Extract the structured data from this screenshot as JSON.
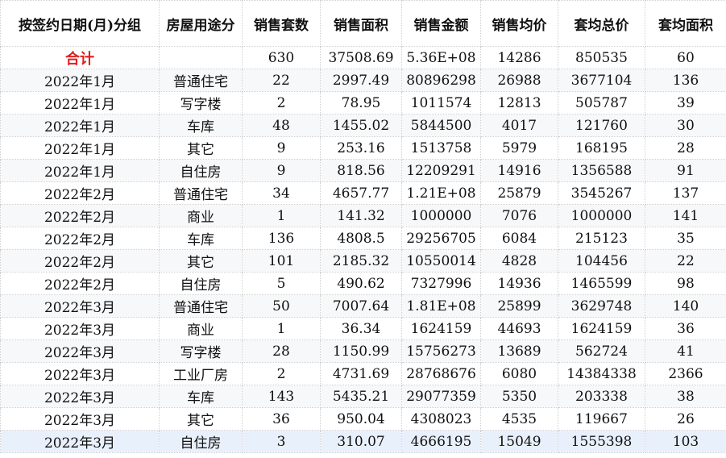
{
  "columns": [
    "按签约日期(月)分组",
    "房屋用途分",
    "销售套数",
    "销售面积",
    "销售金额",
    "销售均价",
    "套均总价",
    "套均面积"
  ],
  "total": {
    "label": "合计",
    "values": [
      "",
      "630",
      "37508.69",
      "5.36E+08",
      "14286",
      "850535",
      "60"
    ]
  },
  "rows": [
    [
      "2022年1月",
      "普通住宅",
      "22",
      "2997.49",
      "80896298",
      "26988",
      "3677104",
      "136"
    ],
    [
      "2022年1月",
      "写字楼",
      "2",
      "78.95",
      "1011574",
      "12813",
      "505787",
      "39"
    ],
    [
      "2022年1月",
      "车库",
      "48",
      "1455.02",
      "5844500",
      "4017",
      "121760",
      "30"
    ],
    [
      "2022年1月",
      "其它",
      "9",
      "253.16",
      "1513758",
      "5979",
      "168195",
      "28"
    ],
    [
      "2022年1月",
      "自住房",
      "9",
      "818.56",
      "12209291",
      "14916",
      "1356588",
      "91"
    ],
    [
      "2022年2月",
      "普通住宅",
      "34",
      "4657.77",
      "1.21E+08",
      "25879",
      "3545267",
      "137"
    ],
    [
      "2022年2月",
      "商业",
      "1",
      "141.32",
      "1000000",
      "7076",
      "1000000",
      "141"
    ],
    [
      "2022年2月",
      "车库",
      "136",
      "4808.5",
      "29256705",
      "6084",
      "215123",
      "35"
    ],
    [
      "2022年2月",
      "其它",
      "101",
      "2185.32",
      "10550014",
      "4828",
      "104456",
      "22"
    ],
    [
      "2022年2月",
      "自住房",
      "5",
      "490.62",
      "7327996",
      "14936",
      "1465599",
      "98"
    ],
    [
      "2022年3月",
      "普通住宅",
      "50",
      "7007.64",
      "1.81E+08",
      "25899",
      "3629748",
      "140"
    ],
    [
      "2022年3月",
      "商业",
      "1",
      "36.34",
      "1624159",
      "44693",
      "1624159",
      "36"
    ],
    [
      "2022年3月",
      "写字楼",
      "28",
      "1150.99",
      "15756273",
      "13689",
      "562724",
      "41"
    ],
    [
      "2022年3月",
      "工业厂房",
      "2",
      "4731.69",
      "28768676",
      "6080",
      "14384338",
      "2366"
    ],
    [
      "2022年3月",
      "车库",
      "143",
      "5435.21",
      "29077359",
      "5350",
      "203338",
      "38"
    ],
    [
      "2022年3月",
      "其它",
      "36",
      "950.04",
      "4308023",
      "4535",
      "119667",
      "26"
    ],
    [
      "2022年3月",
      "自住房",
      "3",
      "310.07",
      "4666195",
      "15049",
      "1555398",
      "103"
    ]
  ]
}
